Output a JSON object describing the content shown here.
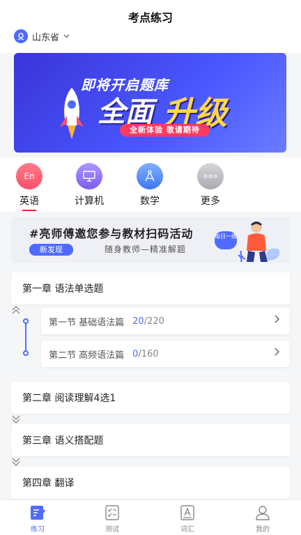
{
  "header": {
    "title": "考点练习",
    "region": "山东省"
  },
  "banner": {
    "line1": "即将开启题库",
    "big1": "全面",
    "big2": "升级",
    "tag": "全新体验 敬请期待"
  },
  "categories": [
    {
      "label": "英语",
      "icon": "En",
      "color": "#ff4f6b",
      "active": true
    },
    {
      "label": "计算机",
      "icon": "computer-icon",
      "color": "#8a6cf6"
    },
    {
      "label": "数学",
      "icon": "compass-icon",
      "color": "#4f8bff"
    },
    {
      "label": "更多",
      "icon": "more-icon",
      "color": "#bfbfc4"
    }
  ],
  "promo": {
    "headline": "#亮师傅邀您参与教材扫码活动",
    "badge": "新发现",
    "subtitle": "随身教师—精准解题",
    "bubble": "每日一练"
  },
  "chapters": [
    {
      "title": "第一章 语法单选题",
      "expanded": true,
      "sections": [
        {
          "title": "第一节 基础语法篇",
          "done": "20",
          "total": "/220"
        },
        {
          "title": "第二节 高频语法篇",
          "done": "0",
          "total": "/160"
        }
      ]
    },
    {
      "title": "第二章 阅读理解4选1"
    },
    {
      "title": "第三章 语义搭配题"
    },
    {
      "title": "第四章 翻译"
    }
  ],
  "tabs": [
    {
      "label": "练习",
      "active": true
    },
    {
      "label": "测试"
    },
    {
      "label": "词汇"
    },
    {
      "label": "我的"
    }
  ],
  "colors": {
    "accent": "#4f6bff",
    "highlight": "#ff3a5f"
  }
}
